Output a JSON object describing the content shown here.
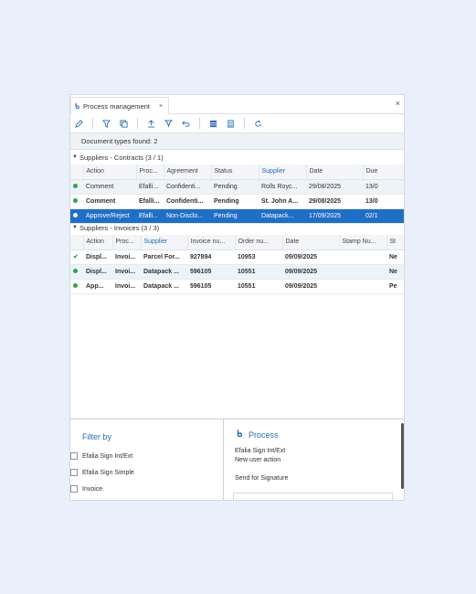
{
  "tab": {
    "label": "Process management",
    "close": "×"
  },
  "window_close": "×",
  "toolbar": {
    "icons": [
      "edit-icon",
      "filter-icon",
      "copy-icon",
      "upload-icon",
      "filter-download-icon",
      "undo-icon",
      "table-icon",
      "report-icon",
      "refresh-icon"
    ]
  },
  "found_text": "Document types found: 2",
  "contracts": {
    "header": "Suppliers - Contracts (3 / 1)",
    "columns": [
      "",
      "Action",
      "Proc...",
      "Agreement",
      "Status",
      "Supplier",
      "Date",
      "Due"
    ],
    "rows": [
      {
        "cells": [
          "Comment",
          "Efalli...",
          "Confidenti...",
          "Pending",
          "Rolls Royc...",
          "29/08/2025",
          "13/0"
        ]
      },
      {
        "cells": [
          "Comment",
          "Efalli...",
          "Confidenti...",
          "Pending",
          "St. John A...",
          "29/08/2025",
          "13/0"
        ]
      },
      {
        "cells": [
          "Approve/Reject",
          "Efalli...",
          "Non-Disclo...",
          "Pending",
          "Datapack...",
          "17/09/2025",
          "02/1"
        ]
      }
    ]
  },
  "invoices": {
    "header": "Suppliers - Invoices (3 / 3)",
    "columns": [
      "",
      "Action",
      "Proc...",
      "Supplier",
      "Invoice nu...",
      "Order nu...",
      "Date",
      "Stamp Nu...",
      "St"
    ],
    "rows": [
      {
        "cells": [
          "Displ...",
          "Invoi...",
          "Parcel For...",
          "927894",
          "10953",
          "09/09/2025",
          "",
          "Ne"
        ]
      },
      {
        "cells": [
          "Displ...",
          "Invoi...",
          "Datapack ...",
          "596105",
          "10551",
          "09/09/2025",
          "",
          "Ne"
        ]
      },
      {
        "cells": [
          "App...",
          "Invoi...",
          "Datapack ...",
          "596105",
          "10551",
          "09/09/2025",
          "",
          "Pe"
        ]
      }
    ]
  },
  "filter": {
    "title": "Filter by",
    "options": [
      "Efalia Sign Int/Ext",
      "Efalia Sign Simple",
      "Invoice"
    ]
  },
  "process": {
    "title": "Process",
    "lines": [
      "Efalia Sign Int/Ext",
      "New user action",
      "Send for Signature"
    ]
  },
  "colors": {
    "accent": "#2a6db5",
    "selected_row": "#1f6fc6",
    "status_green": "#2ea84a",
    "page_bg": "#eaf0fb"
  }
}
